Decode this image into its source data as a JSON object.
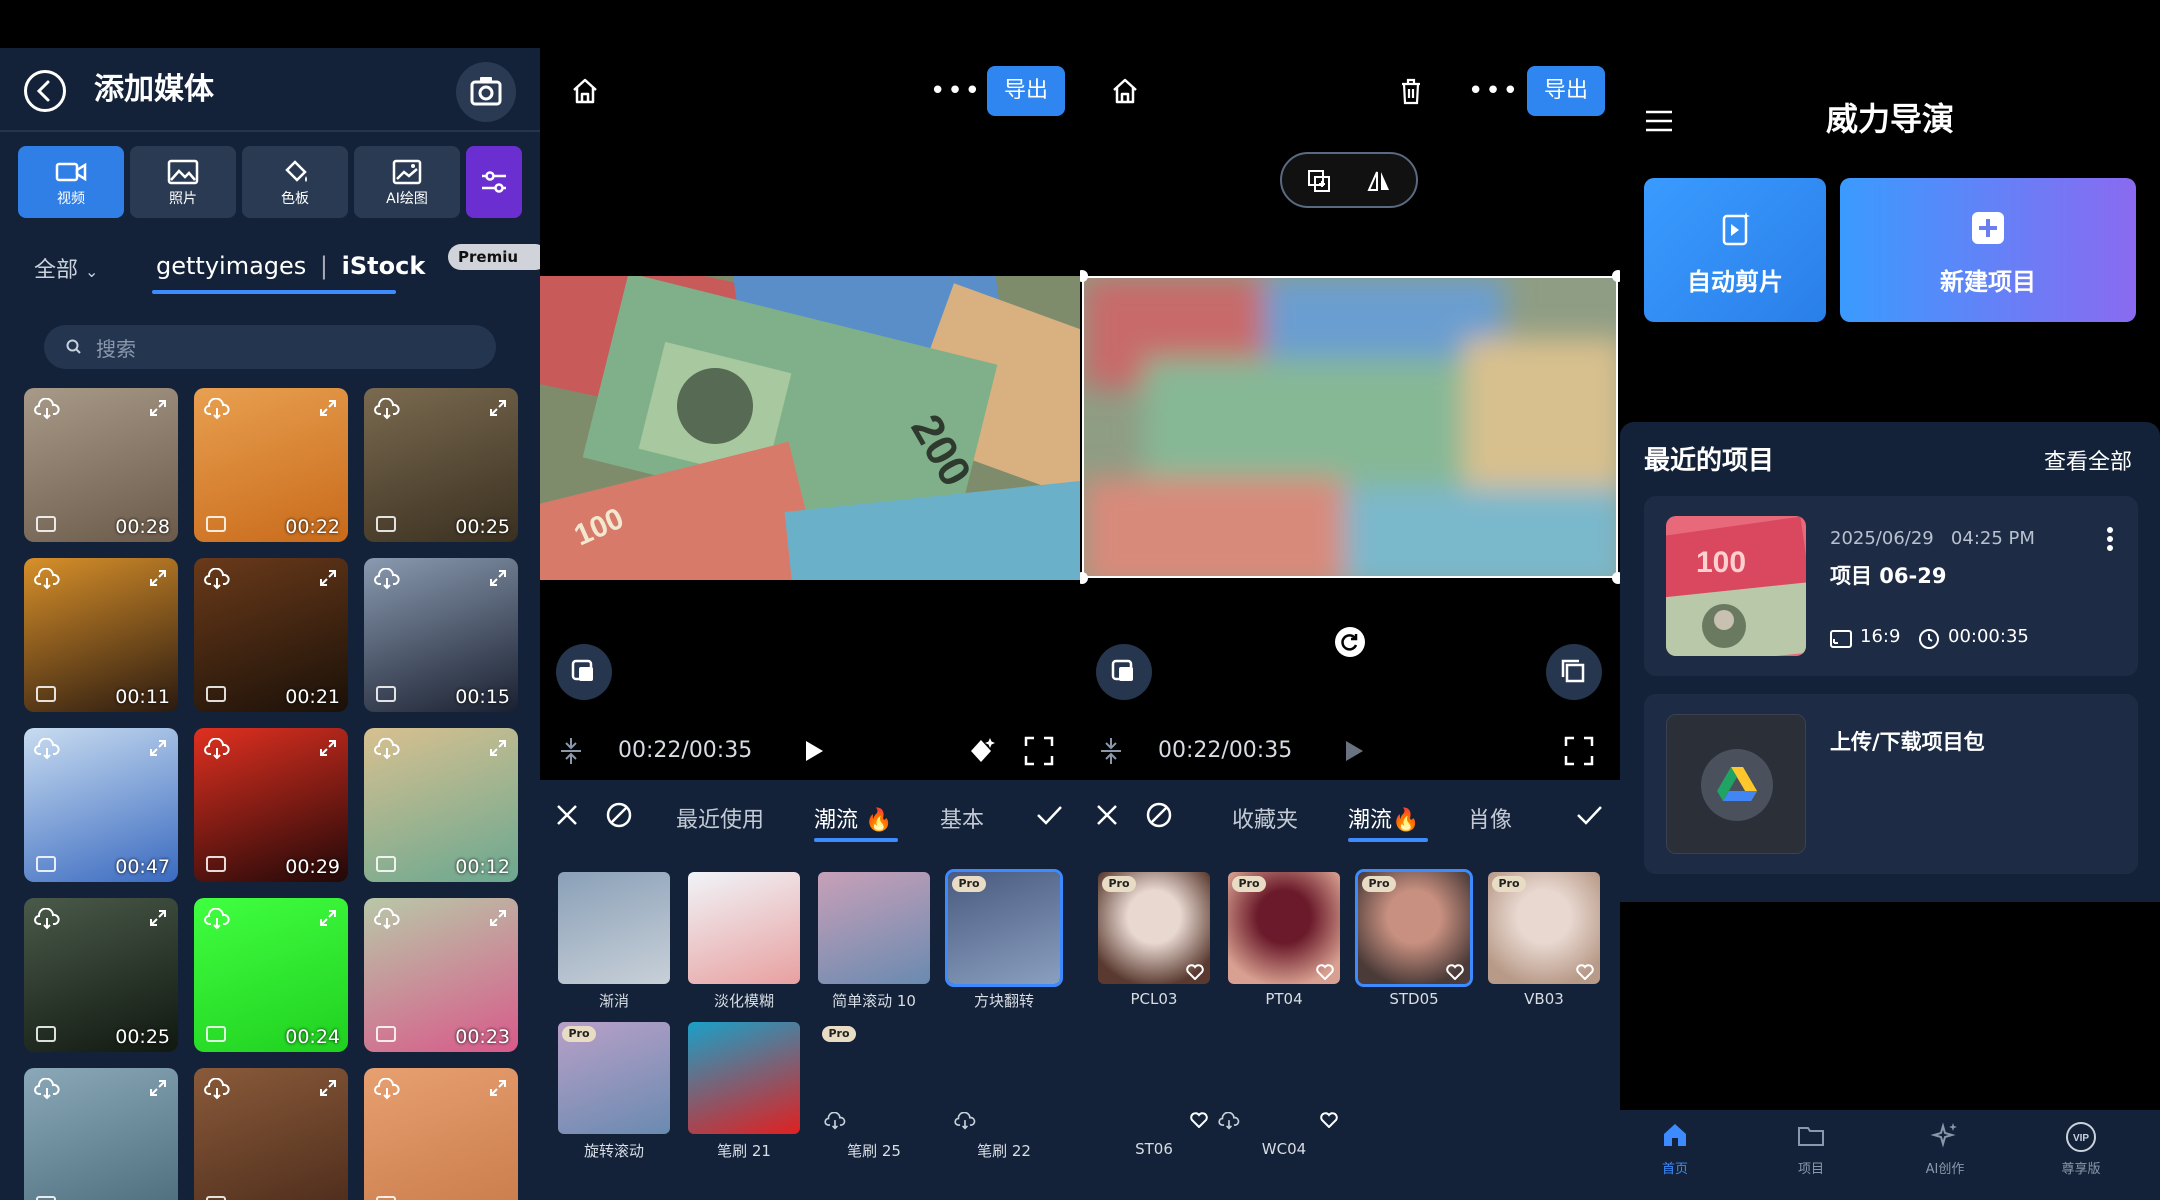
{
  "add_media": {
    "title": "添加媒体",
    "tabs": [
      {
        "label": "视频",
        "icon": "video-icon"
      },
      {
        "label": "照片",
        "icon": "image-icon"
      },
      {
        "label": "色板",
        "icon": "paint-bucket-icon"
      },
      {
        "label": "AI绘图",
        "icon": "ai-image-icon"
      }
    ],
    "filter_dropdown": "全部",
    "provider_getty": "gettyimages",
    "provider_istock": "iStock",
    "provider_separator": "|",
    "premium_badge": "Premiu",
    "search_placeholder": "搜索",
    "thumbnails": [
      {
        "duration": "00:28"
      },
      {
        "duration": "00:22"
      },
      {
        "duration": "00:25"
      },
      {
        "duration": "00:11"
      },
      {
        "duration": "00:21"
      },
      {
        "duration": "00:15"
      },
      {
        "duration": "00:47"
      },
      {
        "duration": "00:29"
      },
      {
        "duration": "00:12"
      },
      {
        "duration": "00:25"
      },
      {
        "duration": "00:24"
      },
      {
        "duration": "00:23"
      }
    ]
  },
  "editor1": {
    "export_label": "导出",
    "time": "00:22/00:35",
    "tabs": [
      "最近使用",
      "潮流",
      "基本"
    ],
    "items": [
      {
        "label": "渐消",
        "pro": false
      },
      {
        "label": "淡化模糊",
        "pro": false
      },
      {
        "label": "简单滚动 10",
        "pro": false
      },
      {
        "label": "方块翻转",
        "pro": true
      },
      {
        "label": "旋转滚动",
        "pro": true
      },
      {
        "label": "笔刷 21",
        "pro": false
      },
      {
        "label": "笔刷 25",
        "pro": true
      },
      {
        "label": "笔刷 22",
        "pro": false
      }
    ],
    "pro_label": "Pro"
  },
  "editor2": {
    "export_label": "导出",
    "time": "00:22/00:35",
    "tabs": [
      "收藏夹",
      "潮流",
      "肖像"
    ],
    "items": [
      {
        "label": "PCL03",
        "pro": true
      },
      {
        "label": "PT04",
        "pro": true
      },
      {
        "label": "STD05",
        "pro": true
      },
      {
        "label": "VB03",
        "pro": true
      },
      {
        "label": "ST06",
        "pro": false
      },
      {
        "label": "WC04",
        "pro": false
      }
    ],
    "pro_label": "Pro"
  },
  "home": {
    "app_title": "威力导演",
    "auto_edit": "自动剪片",
    "new_project": "新建项目",
    "recent_title": "最近的项目",
    "view_all": "查看全部",
    "project": {
      "date": "2025/06/29",
      "time": "04:25 PM",
      "name": "项目 06-29",
      "ratio": "16:9",
      "duration": "00:00:35"
    },
    "upload_label": "上传/下载项目包",
    "nav": [
      {
        "label": "首页",
        "icon": "home-icon"
      },
      {
        "label": "项目",
        "icon": "folder-icon"
      },
      {
        "label": "AI创作",
        "icon": "sparkle-icon"
      },
      {
        "label": "尊享版",
        "icon": "vip-icon"
      }
    ]
  },
  "colors": {
    "accent": "#2f86f0",
    "panel": "#132238",
    "filter_purple": "#6b2fd1"
  }
}
